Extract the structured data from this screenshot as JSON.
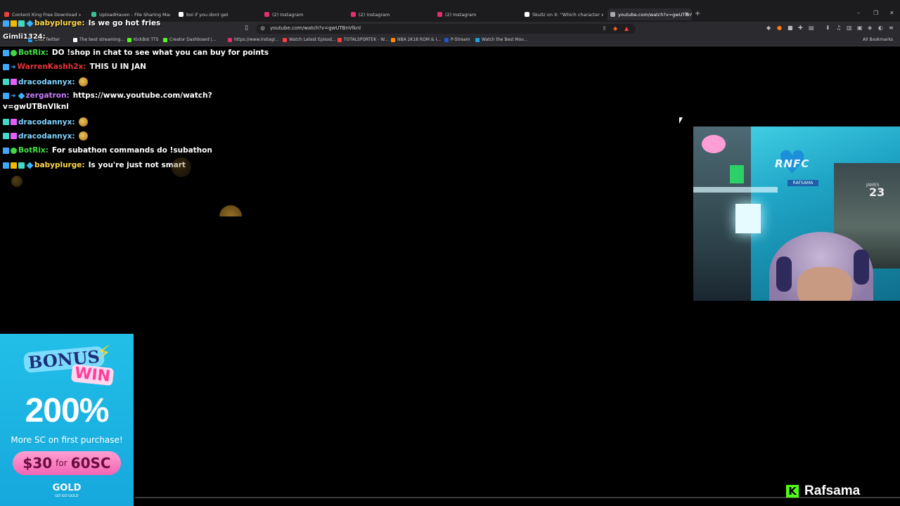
{
  "browser": {
    "tabs": [
      {
        "label": "Content King Free Download » Steam",
        "color": "#e8423f"
      },
      {
        "label": "UploadHaven - File Sharing Made Si",
        "color": "#34c38f"
      },
      {
        "label": "boi if you dont get",
        "color": "#ffffff"
      },
      {
        "label": "(2) Instagram",
        "color": "#e1306c"
      },
      {
        "label": "(2) Instagram",
        "color": "#e1306c"
      },
      {
        "label": "(2) Instagram",
        "color": "#e1306c"
      },
      {
        "label": "Skullz on X: \"Which character w",
        "color": "#ffffff"
      },
      {
        "label": "youtube.com/watch?v=gwUTBnVlknl",
        "color": "#aaaaaa"
      }
    ],
    "new_tab": "+",
    "url": "youtube.com/watch?v=gwUTBnVlknl",
    "bookmarks": [
      {
        "label": "Chat Twitter",
        "color": "#1da1f2"
      },
      {
        "label": "The best streaming...",
        "color": "#ffffff"
      },
      {
        "label": "KickBot TTS",
        "color": "#53fc18"
      },
      {
        "label": "Creator Dashboard |...",
        "color": "#53fc18"
      },
      {
        "label": "https://www.instagr...",
        "color": "#e1306c"
      },
      {
        "label": "Watch Latest Episod...",
        "color": "#ff3b3b"
      },
      {
        "label": "TOTALSPORTEK - W...",
        "color": "#ff3b3b"
      },
      {
        "label": "NBA 2K18 ROM & I...",
        "color": "#ff8a00"
      },
      {
        "label": "P-Stream",
        "color": "#2255cc"
      },
      {
        "label": "Watch the Best Mov...",
        "color": "#20a0e0"
      }
    ],
    "all_bookmarks": "All Bookmarks"
  },
  "overlay": {
    "top_user": "Gimli1324:"
  },
  "chat": [
    {
      "user": "babyplurge:",
      "user_color": "#ffd84a",
      "message": "Is we go hot fries"
    },
    {
      "user": "BotRix:",
      "user_color": "#43e043",
      "message": "DO !shop in chat to see what you can buy for points"
    },
    {
      "user": "WarrenKashh2x:",
      "user_color": "#e8343a",
      "message": "THIS U IN JAN"
    },
    {
      "user": "dracodannyx:",
      "user_color": "#7fd4ff",
      "message": ""
    },
    {
      "user": "zergatron:",
      "user_color": "#c77dff",
      "message": "https://www.youtube.com/watch?",
      "message2": "v=gwUTBnVlknl"
    },
    {
      "user": "dracodannyx:",
      "user_color": "#7fd4ff",
      "message": ""
    },
    {
      "user": "dracodannyx:",
      "user_color": "#7fd4ff",
      "message": ""
    },
    {
      "user": "BotRix:",
      "user_color": "#43e043",
      "message": "For subathon commands do !subathon"
    },
    {
      "user": "babyplurge:",
      "user_color": "#ffd84a",
      "message": "Is you're just not smart"
    }
  ],
  "webcam": {
    "logo": "RNFC",
    "nameplate": "RAFSAMA",
    "jersey_name": "JAMES",
    "jersey_number": "23"
  },
  "ad": {
    "bonus": "BONUS",
    "win": "WIN",
    "percent": "200%",
    "subtitle": "More SC on first purchase!",
    "price": "$30",
    "for": "for",
    "reward": "60SC",
    "brand": "GOLD",
    "brand_sub": "GO GO GOLD"
  },
  "streamer": {
    "platform_icon": "K",
    "name": "Rafsama"
  }
}
